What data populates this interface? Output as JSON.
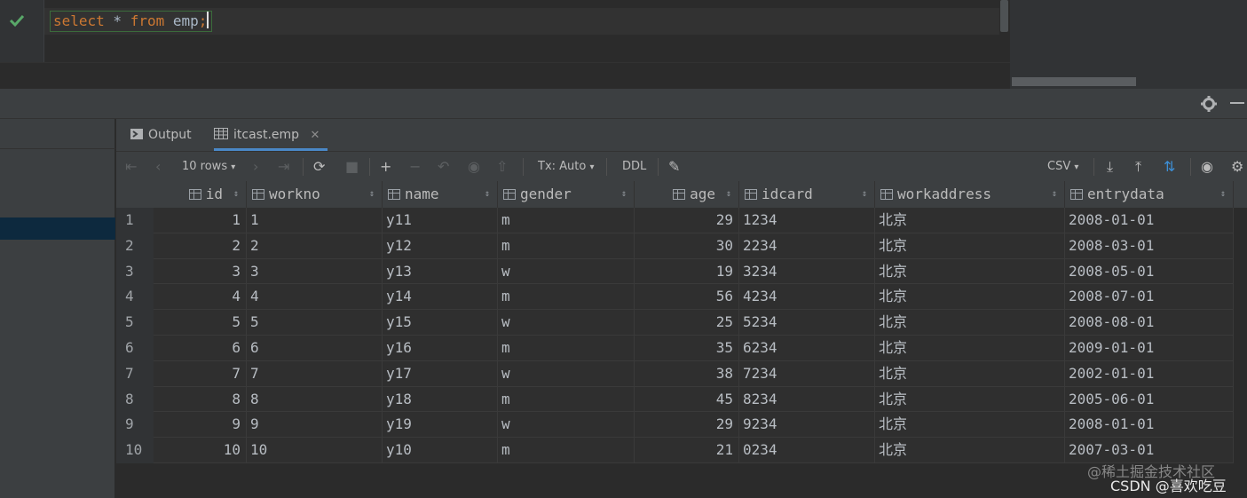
{
  "editor": {
    "sql_keyword_select": "select",
    "sql_star": " * ",
    "sql_keyword_from": "from",
    "sql_table": " emp",
    "sql_semicolon": ";",
    "status_icon": "check-icon",
    "colors": {
      "keyword": "#cc7832",
      "text": "#a9b7c6",
      "check": "#59a869"
    }
  },
  "services_bar": {
    "settings_icon": "gear-icon",
    "minimize_icon": "minimize-icon"
  },
  "tabs": [
    {
      "label": "Output",
      "icon": "console-icon"
    },
    {
      "label": "itcast.emp",
      "icon": "table-icon",
      "active": true
    }
  ],
  "toolbar": {
    "rows_label": "10 rows",
    "tx_label": "Tx: Auto",
    "ddl_label": "DDL",
    "csv_label": "CSV"
  },
  "columns": [
    "id",
    "workno",
    "name",
    "gender",
    "age",
    "idcard",
    "workaddress",
    "entrydata"
  ],
  "rows": [
    {
      "n": "1",
      "id": "1",
      "workno": "1",
      "name": "y11",
      "gender": "m",
      "age": "29",
      "idcard": "1234",
      "workaddress": "北京",
      "entrydata": "2008-01-01"
    },
    {
      "n": "2",
      "id": "2",
      "workno": "2",
      "name": "y12",
      "gender": "m",
      "age": "30",
      "idcard": "2234",
      "workaddress": "北京",
      "entrydata": "2008-03-01"
    },
    {
      "n": "3",
      "id": "3",
      "workno": "3",
      "name": "y13",
      "gender": "w",
      "age": "19",
      "idcard": "3234",
      "workaddress": "北京",
      "entrydata": "2008-05-01"
    },
    {
      "n": "4",
      "id": "4",
      "workno": "4",
      "name": "y14",
      "gender": "m",
      "age": "56",
      "idcard": "4234",
      "workaddress": "北京",
      "entrydata": "2008-07-01"
    },
    {
      "n": "5",
      "id": "5",
      "workno": "5",
      "name": "y15",
      "gender": "w",
      "age": "25",
      "idcard": "5234",
      "workaddress": "北京",
      "entrydata": "2008-08-01"
    },
    {
      "n": "6",
      "id": "6",
      "workno": "6",
      "name": "y16",
      "gender": "m",
      "age": "35",
      "idcard": "6234",
      "workaddress": "北京",
      "entrydata": "2009-01-01"
    },
    {
      "n": "7",
      "id": "7",
      "workno": "7",
      "name": "y17",
      "gender": "w",
      "age": "38",
      "idcard": "7234",
      "workaddress": "北京",
      "entrydata": "2002-01-01"
    },
    {
      "n": "8",
      "id": "8",
      "workno": "8",
      "name": "y18",
      "gender": "m",
      "age": "45",
      "idcard": "8234",
      "workaddress": "北京",
      "entrydata": "2005-06-01"
    },
    {
      "n": "9",
      "id": "9",
      "workno": "9",
      "name": "y19",
      "gender": "w",
      "age": "29",
      "idcard": "9234",
      "workaddress": "北京",
      "entrydata": "2008-01-01"
    },
    {
      "n": "10",
      "id": "10",
      "workno": "10",
      "name": "y10",
      "gender": "m",
      "age": "21",
      "idcard": "0234",
      "workaddress": "北京",
      "entrydata": "2007-03-01"
    }
  ],
  "watermark": {
    "line1": "@稀土掘金技术社区",
    "line2": "CSDN @喜欢吃豆"
  }
}
